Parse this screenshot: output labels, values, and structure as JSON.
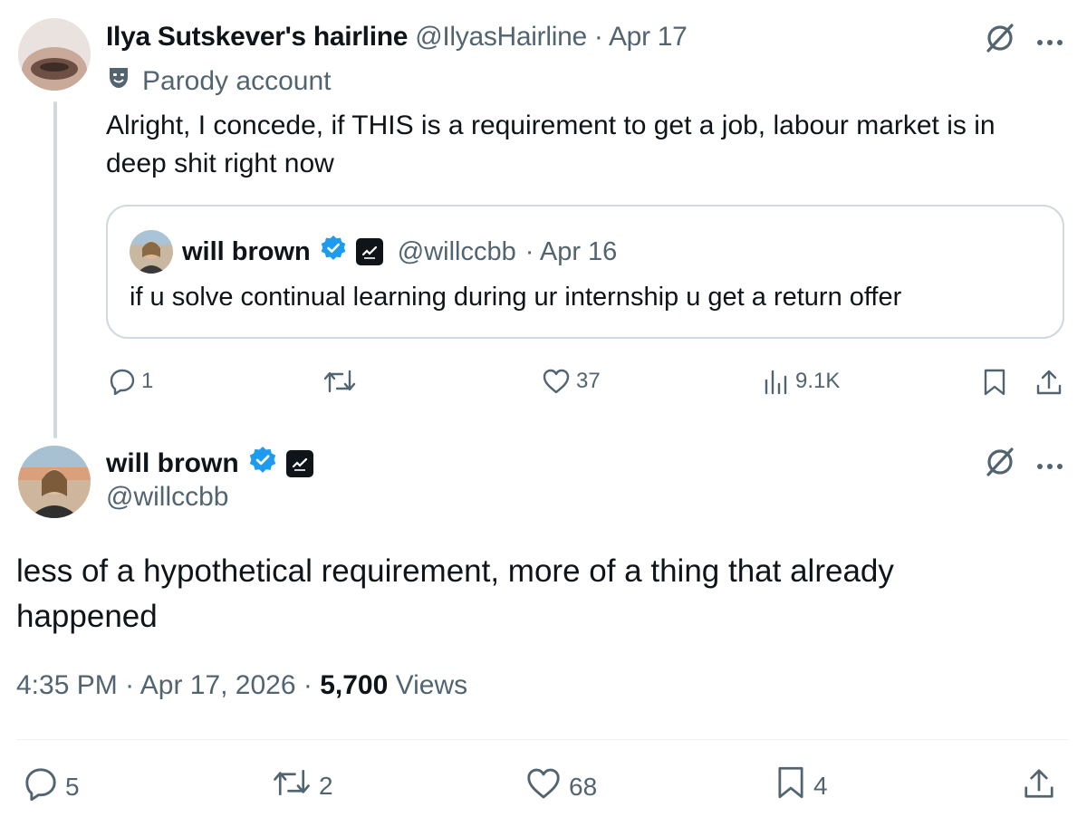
{
  "parent": {
    "display_name": "Ilya Sutskever's hairline",
    "handle": "@IlyasHairline",
    "date": "· Apr 17",
    "parody_label": "Parody account",
    "text": "Alright, I concede, if THIS is a requirement to get a job, labour market is in deep shit right now",
    "quote": {
      "display_name": "will brown",
      "handle": "@willccbb",
      "date": "· Apr 16",
      "text": "if u solve continual learning during ur internship u get a return offer"
    },
    "actions": {
      "replies": "1",
      "likes": "37",
      "views": "9.1K"
    }
  },
  "reply": {
    "display_name": "will brown",
    "handle": "@willccbb",
    "text": "less of a hypothetical requirement, more of a thing that already happened",
    "time": "4:35 PM",
    "date": "· Apr 17, 2026 ·",
    "views_count": "5,700",
    "views_label": "Views",
    "actions": {
      "replies": "5",
      "reposts": "2",
      "likes": "68",
      "bookmarks": "4"
    }
  },
  "colors": {
    "text": "#0f1419",
    "secondary": "#536471",
    "verified": "#1d9bf0",
    "border": "#cfd9de"
  }
}
